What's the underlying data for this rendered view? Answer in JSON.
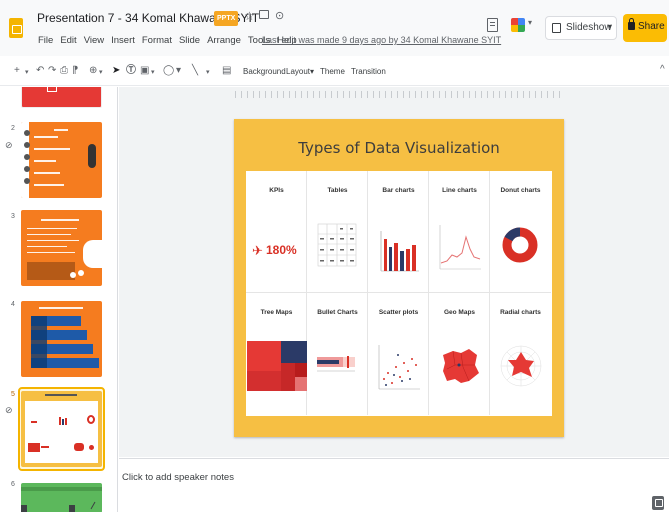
{
  "document": {
    "title": "Presentation 7 - 34 Komal Khawane SYIT",
    "format_badge": "PPTX",
    "last_edit": "Last edit was made 9 days ago by 34 Komal Khawane SYIT"
  },
  "menu": [
    "File",
    "Edit",
    "View",
    "Insert",
    "Format",
    "Slide",
    "Arrange",
    "Tools",
    "Help"
  ],
  "header_buttons": {
    "slideshow_label": "Slideshow",
    "share_label": "Share"
  },
  "toolbar": {
    "background_label": "Background",
    "layout_label": "Layout▾",
    "theme_label": "Theme",
    "transition_label": "Transition"
  },
  "filmstrip": {
    "slide_numbers": [
      "2",
      "3",
      "4",
      "5",
      "6"
    ],
    "selected_slide": "5"
  },
  "slide": {
    "title": "Types of Data Visualization",
    "cells": [
      {
        "label": "KPIs",
        "kpi_value": "180%"
      },
      {
        "label": "Tables"
      },
      {
        "label": "Bar charts"
      },
      {
        "label": "Line charts"
      },
      {
        "label": "Donut charts"
      },
      {
        "label": "Tree Maps"
      },
      {
        "label": "Bullet Charts"
      },
      {
        "label": "Scatter plots"
      },
      {
        "label": "Geo Maps"
      },
      {
        "label": "Radial charts"
      }
    ]
  },
  "notes": {
    "placeholder": "Click to add speaker notes"
  },
  "colors": {
    "accent_yellow": "#fbbc04",
    "slide_background": "#f6bf43",
    "chart_red": "#d93025",
    "chart_navy": "#2b3a67",
    "thumb_orange": "#f57c1f",
    "thumb_blue": "#1e5aa8"
  }
}
